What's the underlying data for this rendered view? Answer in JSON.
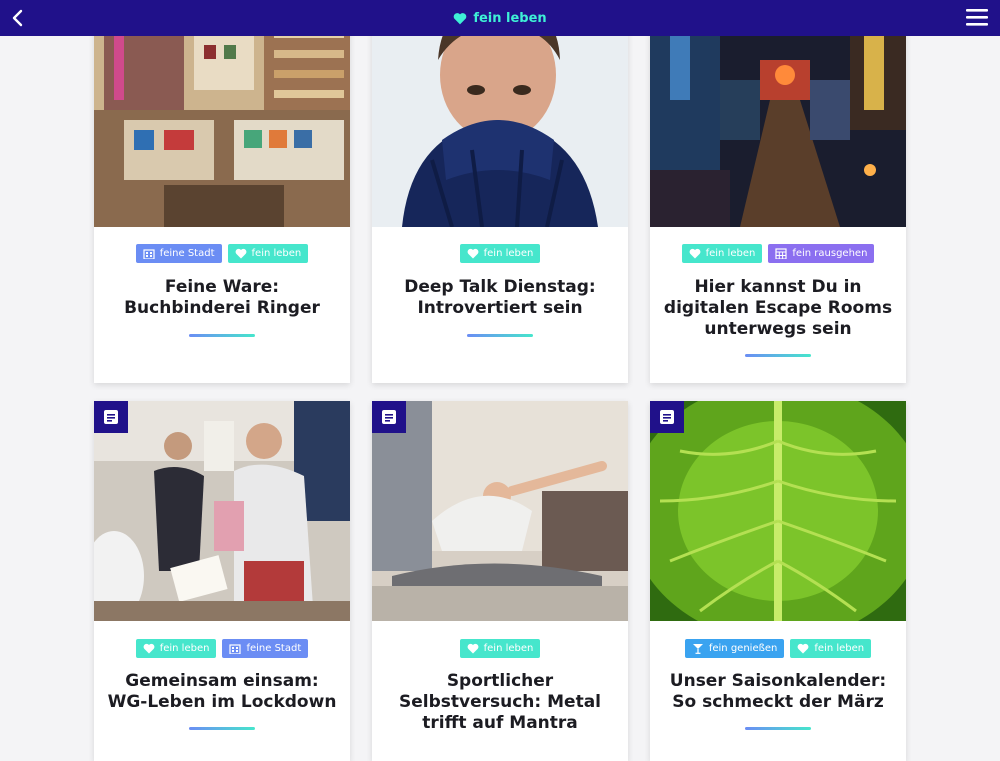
{
  "header": {
    "brand": "fein leben",
    "back_icon": "chevron-left-icon",
    "menu_icon": "hamburger-menu-icon",
    "brand_color": "#3ef0d6",
    "bg_color": "#20118a"
  },
  "cards": [
    {
      "tags": [
        {
          "label": "feine Stadt",
          "icon": "building-icon",
          "kind": "stadt"
        },
        {
          "label": "fein leben",
          "icon": "heart-icon",
          "kind": "leben"
        }
      ],
      "title": "Feine Ware: Buchbinderei Ringer"
    },
    {
      "tags": [
        {
          "label": "fein leben",
          "icon": "heart-icon",
          "kind": "leben"
        }
      ],
      "title": "Deep Talk Dienstag: Introvertiert sein"
    },
    {
      "tags": [
        {
          "label": "fein leben",
          "icon": "heart-icon",
          "kind": "leben"
        },
        {
          "label": "fein rausgehen",
          "icon": "calendar-grid-icon",
          "kind": "rausgehen"
        }
      ],
      "title": "Hier kannst Du in digitalen Escape Rooms unterwegs sein"
    },
    {
      "tags": [
        {
          "label": "fein leben",
          "icon": "heart-icon",
          "kind": "leben"
        },
        {
          "label": "feine Stadt",
          "icon": "building-icon",
          "kind": "stadt"
        }
      ],
      "title": "Gemeinsam einsam: WG-Leben im Lockdown"
    },
    {
      "tags": [
        {
          "label": "fein leben",
          "icon": "heart-icon",
          "kind": "leben"
        }
      ],
      "title": "Sportlicher Selbstversuch: Metal trifft auf Mantra"
    },
    {
      "tags": [
        {
          "label": "fein genießen",
          "icon": "cocktail-icon",
          "kind": "geniessen"
        },
        {
          "label": "fein leben",
          "icon": "heart-icon",
          "kind": "leben"
        }
      ],
      "title": "Unser Saisonkalender: So schmeckt der März"
    }
  ]
}
